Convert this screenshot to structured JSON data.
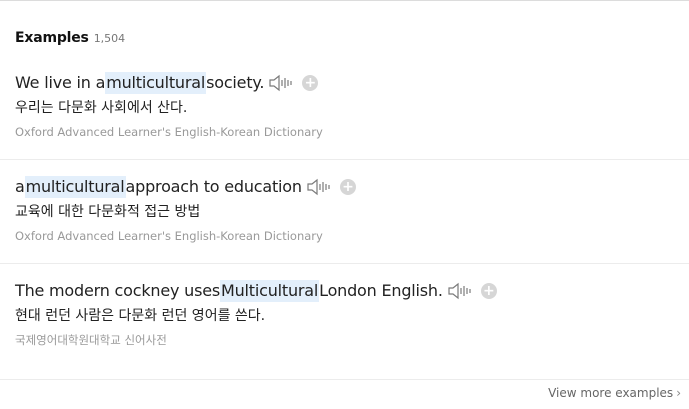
{
  "header": {
    "title": "Examples",
    "count": "1,504"
  },
  "examples": [
    {
      "before": "We live in a ",
      "highlight": "multicultural",
      "after": " society.",
      "translation": "우리는 다문화 사회에서 산다.",
      "source": "Oxford Advanced Learner's English-Korean Dictionary"
    },
    {
      "before": "a ",
      "highlight": "multicultural",
      "after": " approach to education",
      "translation": "교육에 대한 다문화적 접근 방법",
      "source": "Oxford Advanced Learner's English-Korean Dictionary"
    },
    {
      "before": "The modern cockney uses ",
      "highlight": "Multicultural",
      "after": " London English.",
      "translation": "현대 런던 사람은 다문화 런던 영어를 쓴다.",
      "source": "국제영어대학원대학교 신어사전"
    }
  ],
  "icons": {
    "speaker": "speaker-icon",
    "add": "plus-icon"
  },
  "footer": {
    "more_label": "View more examples",
    "chevron": "›"
  },
  "colors": {
    "highlight_bg": "#e3effb",
    "source_text": "#999999",
    "plus_bg": "#d6d6d6"
  }
}
